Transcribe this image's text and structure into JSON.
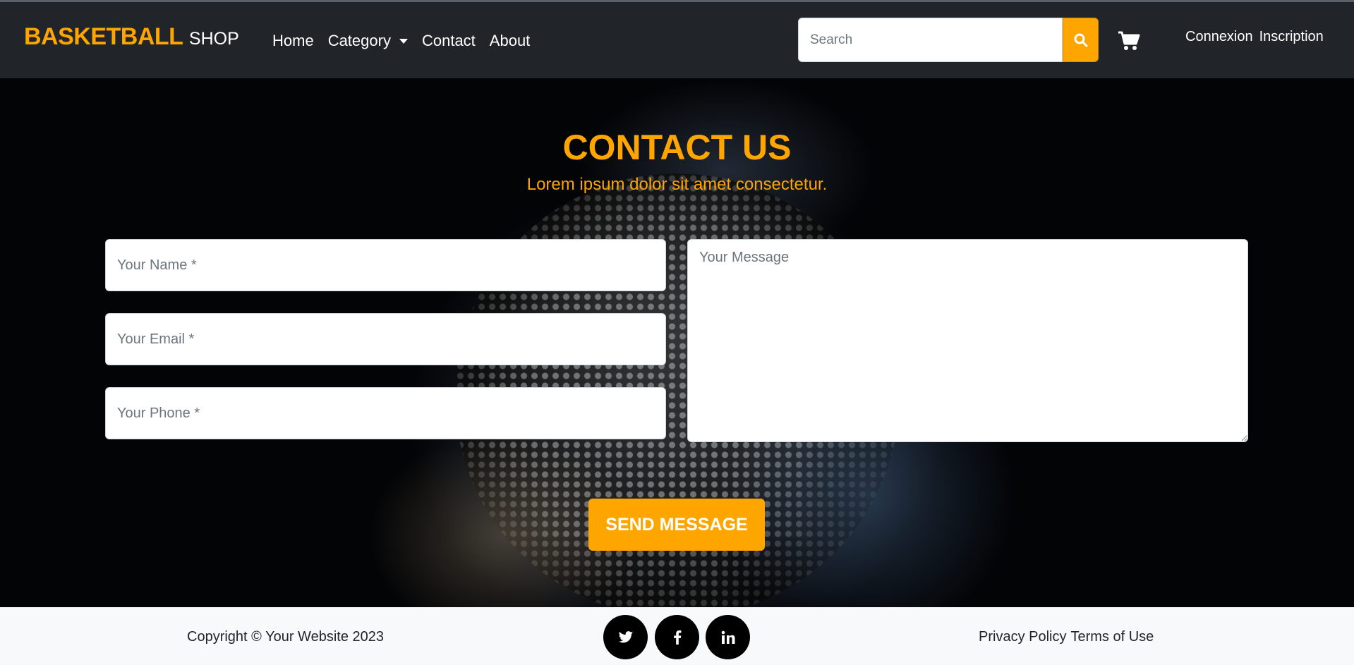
{
  "brand": {
    "main": "BASKETBALL",
    "sub": "SHOP"
  },
  "nav": {
    "links": [
      "Home",
      "Category",
      "Contact",
      "About"
    ]
  },
  "search": {
    "placeholder": "Search",
    "button_icon": "search-icon"
  },
  "cart": {
    "icon": "cart-icon"
  },
  "auth": {
    "login": "Connexion",
    "register": "Inscription"
  },
  "hero": {
    "title": "CONTACT US",
    "subtitle": "Lorem ipsum dolor sit amet consectetur."
  },
  "form": {
    "name_placeholder": "Your Name *",
    "email_placeholder": "Your Email *",
    "phone_placeholder": "Your Phone *",
    "message_placeholder": "Your Message",
    "submit_label": "SEND MESSAGE"
  },
  "footer": {
    "copyright": "Copyright © Your Website 2023",
    "social": [
      "twitter-icon",
      "facebook-icon",
      "linkedin-icon"
    ],
    "privacy": "Privacy Policy",
    "terms": "Terms of Use"
  },
  "colors": {
    "accent": "#ffa500",
    "navbar_bg": "#212529",
    "footer_bg": "#f8f9fa"
  }
}
